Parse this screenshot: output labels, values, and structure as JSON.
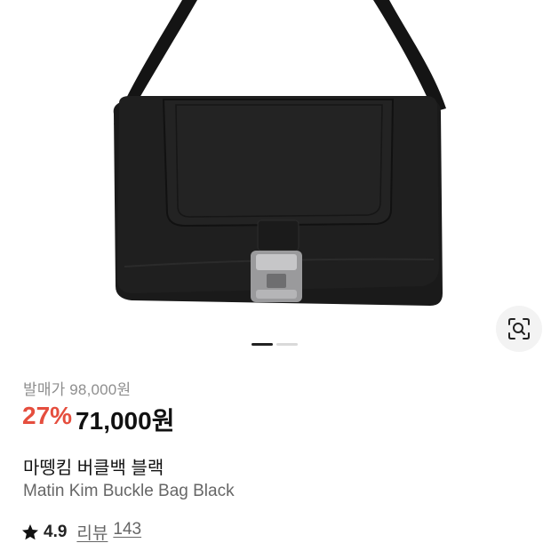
{
  "product": {
    "image_alt": "product-photo",
    "pager": {
      "count": 2,
      "active": 0
    },
    "retail_label": "발매가",
    "retail_price": "98,000원",
    "discount": "27%",
    "sale_price": "71,000원",
    "name_ko": "마뗑킴 버클백 블랙",
    "name_en": "Matin Kim Buckle Bag Black",
    "rating": "4.9",
    "review_label": "리뷰",
    "review_count": "143"
  },
  "icons": {
    "lens": "visual-search-icon",
    "star": "star-icon"
  },
  "colors": {
    "discount": "#e54e3e",
    "text": "#111111",
    "muted": "#8e8e8e"
  }
}
